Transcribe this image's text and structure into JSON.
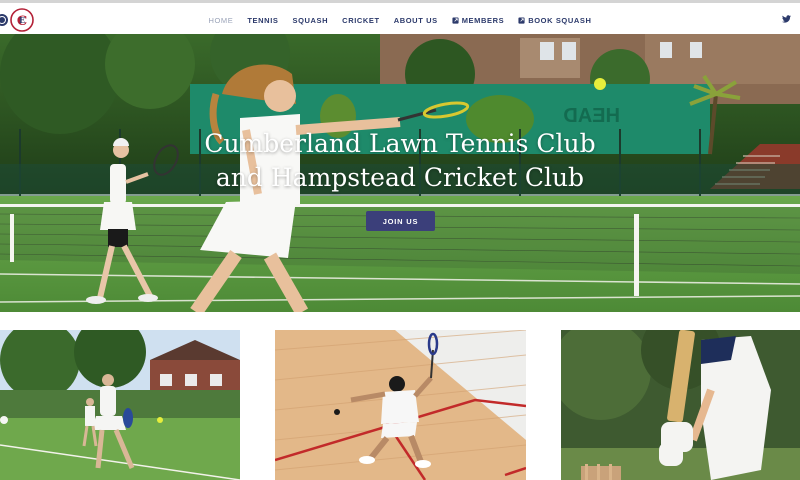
{
  "header": {
    "logo_alt": "CLTC crest",
    "nav": [
      {
        "label": "HOME",
        "active": true
      },
      {
        "label": "TENNIS",
        "active": false
      },
      {
        "label": "SQUASH",
        "active": false
      },
      {
        "label": "CRICKET",
        "active": false
      },
      {
        "label": "ABOUT US",
        "active": false
      },
      {
        "label": "MEMBERS",
        "active": false,
        "icon": "external-link-icon"
      },
      {
        "label": "BOOK SQUASH",
        "active": false,
        "icon": "external-link-icon"
      }
    ],
    "social_icon": "twitter-icon"
  },
  "hero": {
    "title_line1": "Cumberland Lawn Tennis Club",
    "title_line2": "and Hampstead Cricket Club",
    "cta_label": "JOIN US",
    "banner_text": "HEAD"
  },
  "tiles": [
    {
      "name": "tennis",
      "image": "tennis-doubles-photo"
    },
    {
      "name": "squash",
      "image": "squash-player-photo"
    },
    {
      "name": "cricket",
      "image": "cricket-batsman-photo"
    }
  ],
  "colors": {
    "nav_text": "#2c3a6b",
    "nav_active": "#9aa3b8",
    "cta_bg": "#3b3f7a",
    "grass": "#5f9a45",
    "windbreak": "#1e8a6a"
  }
}
